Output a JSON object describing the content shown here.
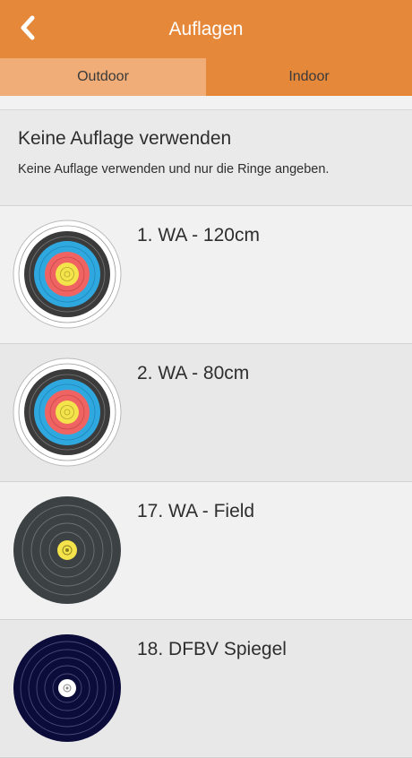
{
  "header": {
    "title": "Auflagen",
    "back_icon": "chevron-left-icon"
  },
  "tabs": [
    {
      "label": "Outdoor",
      "active": true
    },
    {
      "label": "Indoor",
      "active": false
    }
  ],
  "none_option": {
    "title": "Keine Auflage verwenden",
    "description": "Keine Auflage verwenden und nur die Ringe angeben."
  },
  "targets": [
    {
      "label": "1. WA - 120cm",
      "icon": "wa-full-face-target-icon"
    },
    {
      "label": "2. WA - 80cm",
      "icon": "wa-full-face-target-icon"
    },
    {
      "label": "17. WA - Field",
      "icon": "wa-field-target-icon"
    },
    {
      "label": "18. DFBV Spiegel",
      "icon": "dfbv-spiegel-target-icon"
    }
  ],
  "colors": {
    "header": "#e6883a",
    "tab_active": "#f0ad77",
    "ring_white": "#ffffff",
    "ring_black": "#3b3b3b",
    "ring_blue": "#2fa8e0",
    "ring_red": "#ef6463",
    "ring_gold": "#f4e34a",
    "field_dark": "#3c4144",
    "spiegel_navy": "#0c0c3a"
  }
}
